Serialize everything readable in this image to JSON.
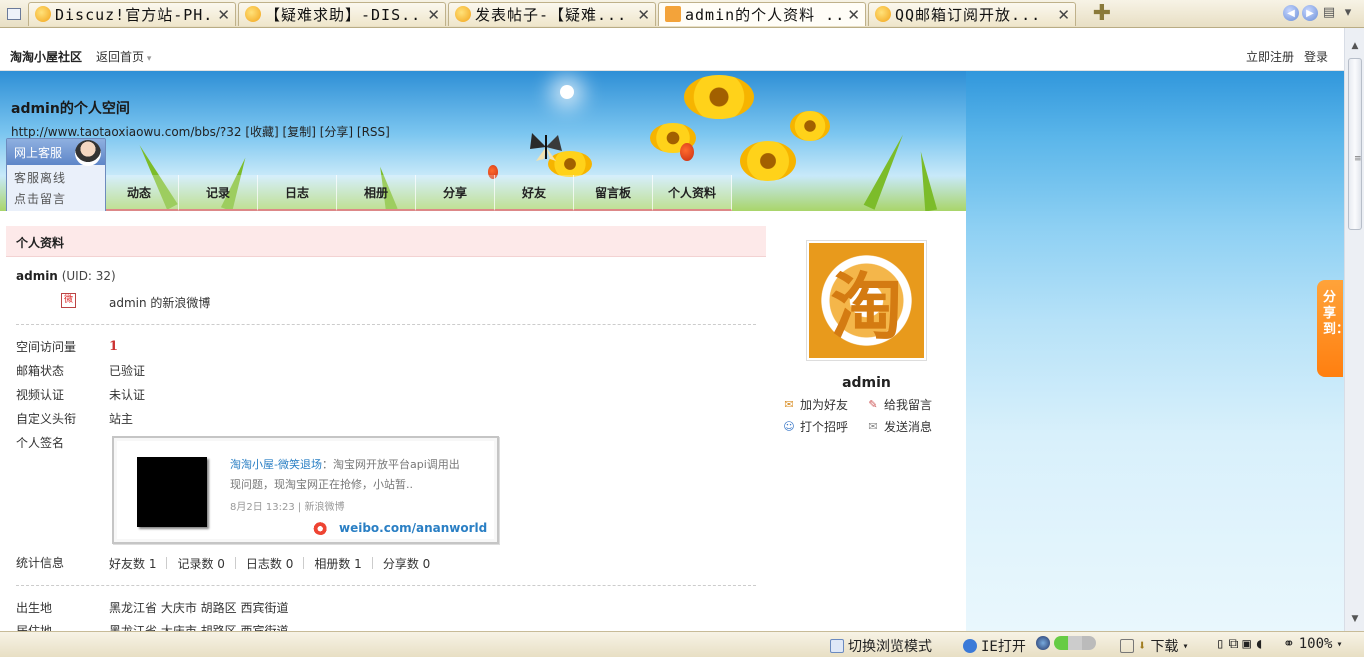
{
  "browser": {
    "tabs": [
      {
        "title": "Discuz!官方站-PH..."
      },
      {
        "title": "【疑难求助】-DIS..."
      },
      {
        "title": "发表帖子-【疑难..."
      },
      {
        "title": "admin的个人资料 ...",
        "active": true
      },
      {
        "title": "QQ邮箱订阅开放..."
      }
    ],
    "close_glyph": "✕",
    "add_glyph": "✚"
  },
  "sitebar": {
    "site_name": "淘淘小屋社区",
    "back_home": "返回首页",
    "register": "立即注册",
    "login": "登录"
  },
  "header": {
    "space_title": "admin的个人空间",
    "space_url": "http://www.taotaoxiaowu.com/bbs/?32 [收藏] [复制] [分享] [RSS]",
    "nav": [
      "动态",
      "记录",
      "日志",
      "相册",
      "分享",
      "好友",
      "留言板",
      "个人资料"
    ]
  },
  "kefu": {
    "title": "网上客服",
    "offline": "客服离线",
    "leave_msg": "点击留言"
  },
  "profile": {
    "section_title": "个人资料",
    "username": "admin",
    "uid": "(UID: 32)",
    "weibo_link": "admin 的新浪微博",
    "rows": [
      {
        "label": "空间访问量",
        "value": "1"
      },
      {
        "label": "邮箱状态",
        "value": "已验证"
      },
      {
        "label": "视频认证",
        "value": "未认证"
      },
      {
        "label": "自定义头衔",
        "value": "站主"
      },
      {
        "label": "个人签名",
        "value": ""
      }
    ],
    "signature": {
      "author": "淘淘小屋-微笑退场",
      "text": "：淘宝网开放平台api调用出现问题，现淘宝网正在抢修，小站暂..",
      "meta": "8月2日 13:23 | 新浪微博",
      "weibo_url": "weibo.com/ananworld"
    },
    "stats_label": "统计信息",
    "stats": [
      "好友数 1",
      "记录数 0",
      "日志数 0",
      "相册数 1",
      "分享数 0"
    ],
    "birthplace_label": "出生地",
    "birthplace": "黑龙江省 大庆市 胡路区 西宾街道",
    "residence_label": "居住地",
    "residence": "黑龙江省 大庆市 胡路区 西宾街道"
  },
  "card": {
    "avatar_glyph": "淘",
    "name": "admin",
    "actions": {
      "add_friend": "加为好友",
      "leave_msg": "给我留言",
      "greet": "打个招呼",
      "send_msg": "发送消息"
    }
  },
  "share_float": "分享到：",
  "statusbar": {
    "browse_mode": "切换浏览模式",
    "ie_open": "IE打开",
    "download": "下载",
    "zoom": "100%"
  }
}
